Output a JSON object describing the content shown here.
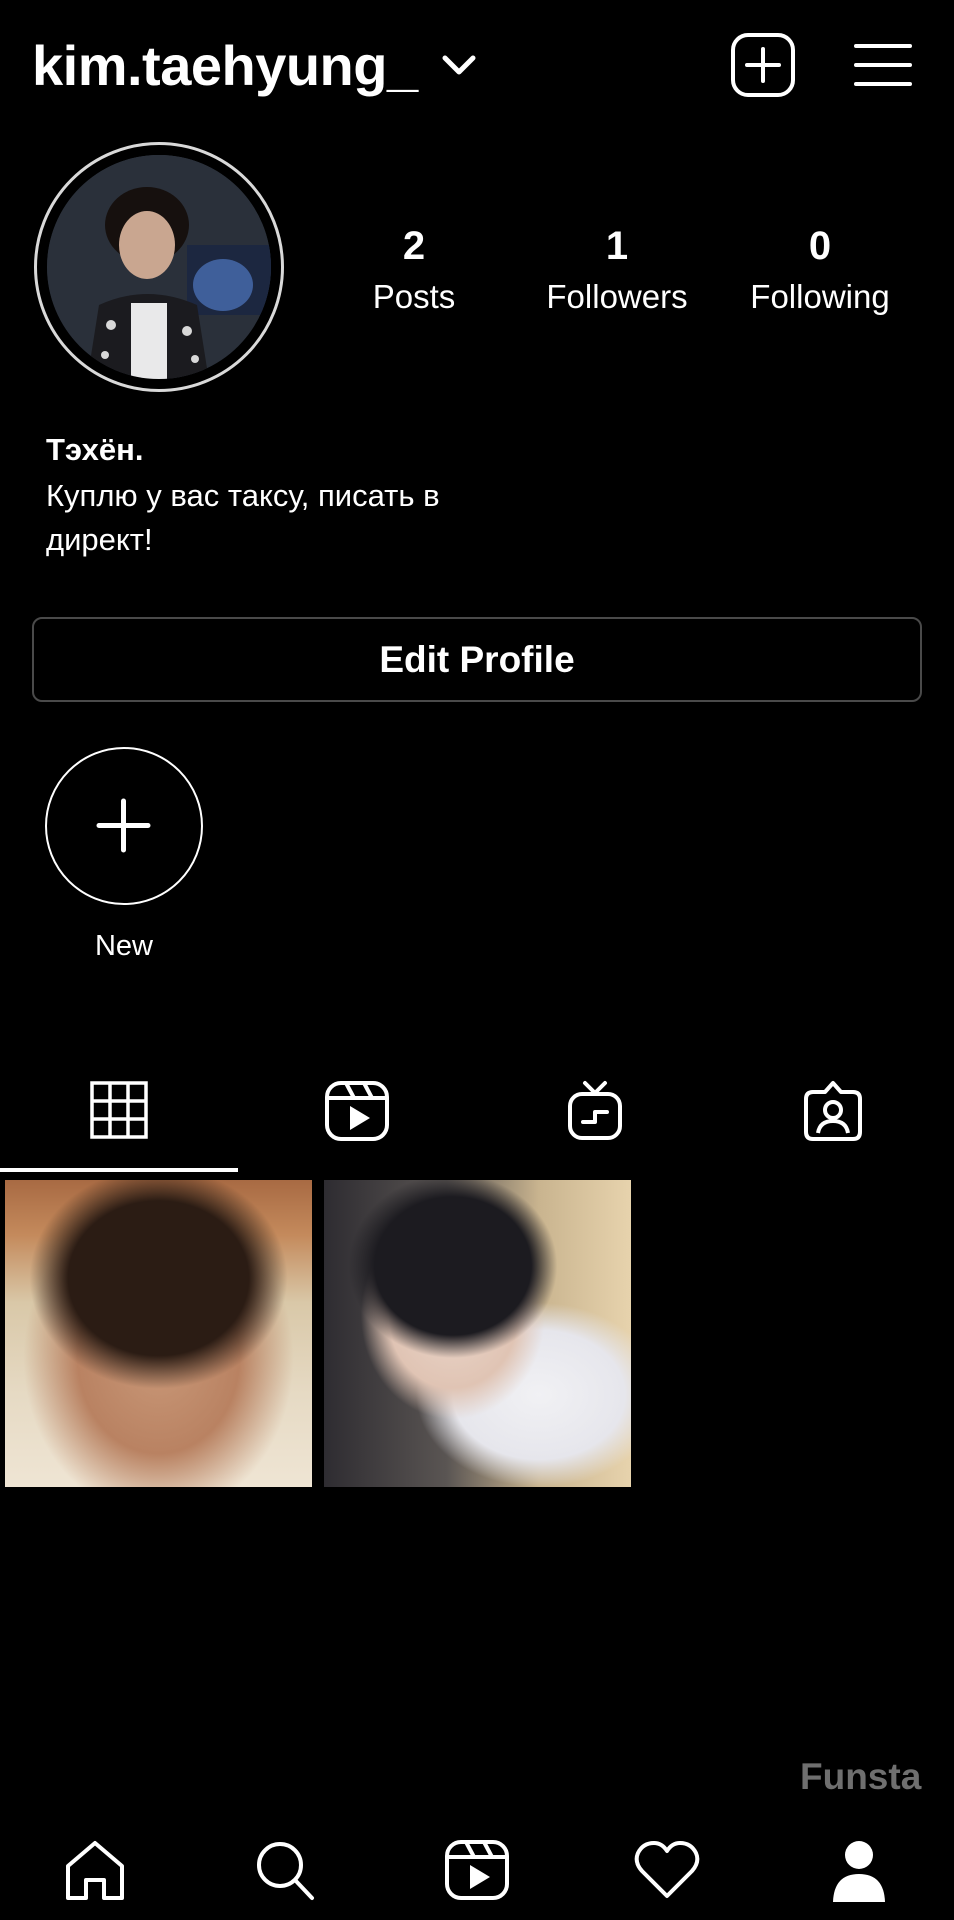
{
  "header": {
    "username": "kim.taehyung_",
    "chevron_icon": "chevron-down-icon",
    "new_post_icon": "plus-square-icon",
    "menu_icon": "hamburger-menu-icon"
  },
  "profile": {
    "avatar_icon": "profile-photo",
    "stats": [
      {
        "value": "2",
        "label": "Posts"
      },
      {
        "value": "1",
        "label": "Followers"
      },
      {
        "value": "0",
        "label": "Following"
      }
    ],
    "bio_name": "Тэхён.",
    "bio_line1": "Куплю у вас таксу, писать в",
    "bio_line2": "директ!",
    "edit_button": "Edit Profile"
  },
  "highlights": {
    "new_label": "New",
    "new_icon": "plus-icon"
  },
  "tabs": [
    {
      "name": "grid",
      "icon": "grid-icon",
      "active": true
    },
    {
      "name": "reels",
      "icon": "reels-icon",
      "active": false
    },
    {
      "name": "igtv",
      "icon": "igtv-icon",
      "active": false
    },
    {
      "name": "tagged",
      "icon": "tagged-icon",
      "active": false
    }
  ],
  "posts": [
    {
      "icon": "post-photo-1"
    },
    {
      "icon": "post-photo-2"
    }
  ],
  "watermark": "Funsta",
  "bottom_nav": [
    {
      "icon": "home-icon"
    },
    {
      "icon": "search-icon"
    },
    {
      "icon": "reels-icon"
    },
    {
      "icon": "heart-icon"
    },
    {
      "icon": "profile-icon",
      "active": true
    }
  ],
  "colors": {
    "background": "#000000",
    "text": "#ffffff",
    "border": "#4a4a4a",
    "watermark": "#6f6f6f"
  }
}
